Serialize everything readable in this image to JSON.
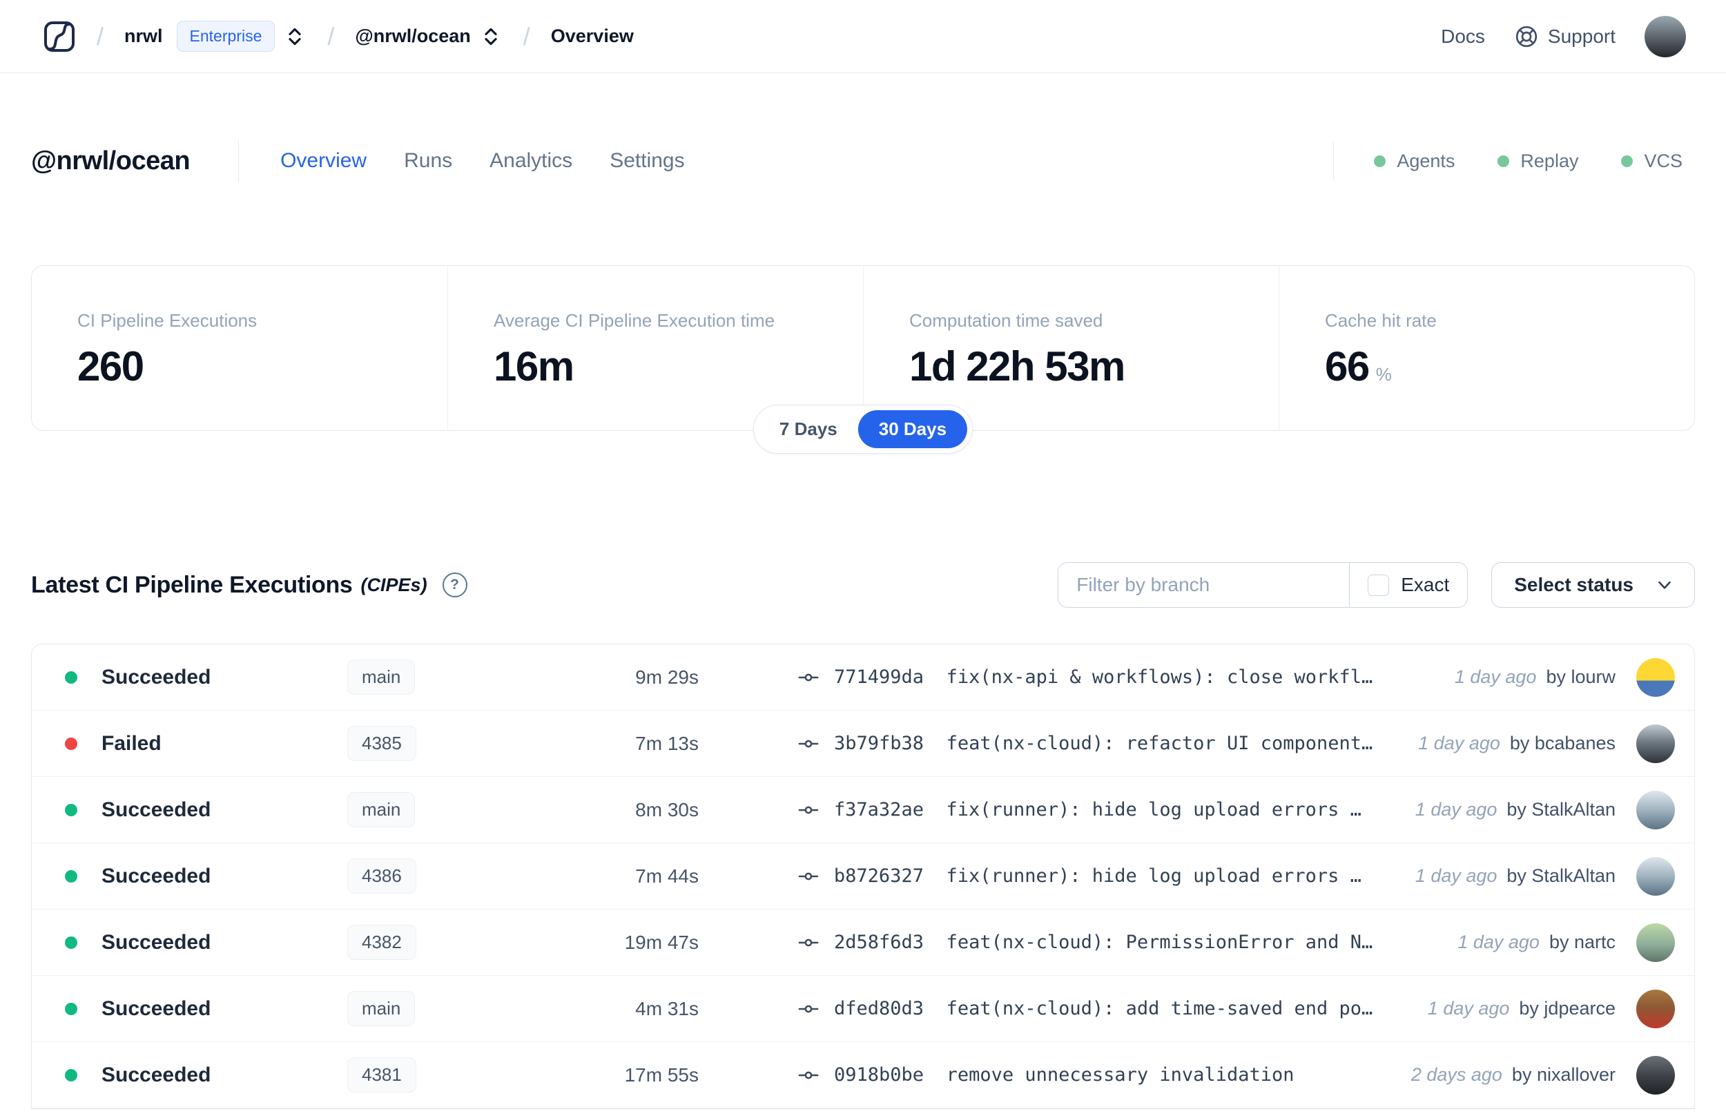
{
  "topnav": {
    "org": "nrwl",
    "plan_badge": "Enterprise",
    "workspace": "@nrwl/ocean",
    "page": "Overview",
    "docs_label": "Docs",
    "support_label": "Support",
    "avatar_style": "background:linear-gradient(180deg,#9aa7b0 0%,#5a6168 55%,#23272c 100%)"
  },
  "header": {
    "workspace_title": "@nrwl/ocean",
    "tabs": [
      "Overview",
      "Runs",
      "Analytics",
      "Settings"
    ],
    "active_tab": "Overview",
    "status_indicators": [
      "Agents",
      "Replay",
      "VCS"
    ]
  },
  "stats": {
    "cards": [
      {
        "label": "CI Pipeline Executions",
        "value": "260",
        "suffix": ""
      },
      {
        "label": "Average CI Pipeline Execution time",
        "value": "16m",
        "suffix": ""
      },
      {
        "label": "Computation time saved",
        "value": "1d 22h 53m",
        "suffix": ""
      },
      {
        "label": "Cache hit rate",
        "value": "66",
        "suffix": "%"
      }
    ],
    "range_toggle": {
      "options": [
        "7 Days",
        "30 Days"
      ],
      "selected": "30 Days"
    }
  },
  "cipe_section": {
    "title": "Latest CI Pipeline Executions",
    "subtitle": "(CIPEs)",
    "help_glyph": "?",
    "filter_placeholder": "Filter by branch",
    "exact_label": "Exact",
    "select_status_label": "Select status"
  },
  "table": {
    "rows": [
      {
        "status": "Succeeded",
        "branch": "main",
        "duration": "9m 29s",
        "commit_hash": "771499da",
        "commit_message": "fix(nx-api & workflows): close workfl…",
        "time_ago": "1 day ago",
        "by_author": "by lourw",
        "avatar_style": "background:linear-gradient(180deg,#fdd835 0%,#fdd835 58%,#4a78b8 58%,#4a78b8 100%)"
      },
      {
        "status": "Failed",
        "branch": "4385",
        "duration": "7m 13s",
        "commit_hash": "3b79fb38",
        "commit_message": "feat(nx-cloud): refactor UI component…",
        "time_ago": "1 day ago",
        "by_author": "by bcabanes",
        "avatar_style": "background:linear-gradient(180deg,#c2cad1 0%,#6f7a82 45%,#2e3338 100%)"
      },
      {
        "status": "Succeeded",
        "branch": "main",
        "duration": "8m 30s",
        "commit_hash": "f37a32ae",
        "commit_message": "fix(runner): hide log upload errors b…",
        "time_ago": "1 day ago",
        "by_author": "by StalkAltan",
        "avatar_style": "background:linear-gradient(180deg,#dfe7ec 0%,#9fb3c0 50%,#5d7383 100%)"
      },
      {
        "status": "Succeeded",
        "branch": "4386",
        "duration": "7m 44s",
        "commit_hash": "b8726327",
        "commit_message": "fix(runner): hide log upload errors b…",
        "time_ago": "1 day ago",
        "by_author": "by StalkAltan",
        "avatar_style": "background:linear-gradient(180deg,#dfe7ec 0%,#9fb3c0 50%,#5d7383 100%)"
      },
      {
        "status": "Succeeded",
        "branch": "4382",
        "duration": "19m 47s",
        "commit_hash": "2d58f6d3",
        "commit_message": "feat(nx-cloud): PermissionError and N…",
        "time_ago": "1 day ago",
        "by_author": "by nartc",
        "avatar_style": "background:linear-gradient(180deg,#bcd9a8 0%,#8fae9a 55%,#5f7568 100%)"
      },
      {
        "status": "Succeeded",
        "branch": "main",
        "duration": "4m 31s",
        "commit_hash": "dfed80d3",
        "commit_message": "feat(nx-cloud): add time-saved end po…",
        "time_ago": "1 day ago",
        "by_author": "by jdpearce",
        "avatar_style": "background:linear-gradient(180deg,#a9793f 0%,#8d5a35 45%,#c0392b 100%)"
      },
      {
        "status": "Succeeded",
        "branch": "4381",
        "duration": "17m 55s",
        "commit_hash": "0918b0be",
        "commit_message": "remove unnecessary invalidation",
        "time_ago": "2 days ago",
        "by_author": "by nixallover",
        "avatar_style": "background:linear-gradient(180deg,#6b6f76 0%,#3c4046 55%,#1f2226 100%)"
      }
    ]
  },
  "colors": {
    "accent_blue": "#2563eb",
    "succeeded_green": "#10b981",
    "failed_red": "#ef4444",
    "legend_green": "#77c89b",
    "badge_bg": "#eff4ff",
    "border_gray": "#e4e8ee"
  }
}
